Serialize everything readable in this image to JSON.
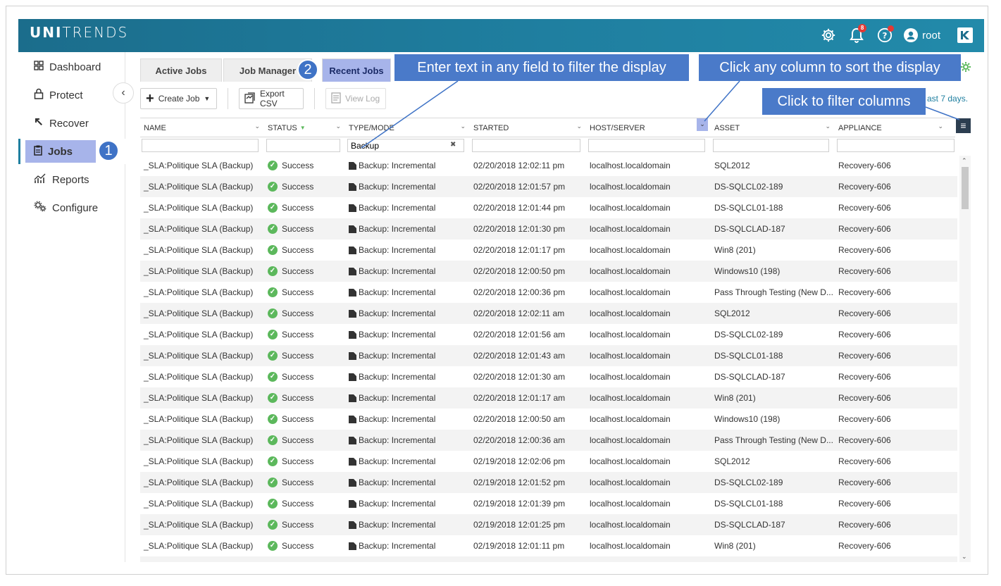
{
  "header": {
    "logo_bold": "UNI",
    "logo_light": "TRENDS",
    "notifications_count": "8",
    "user": "root"
  },
  "sidebar": {
    "items": [
      {
        "label": "Dashboard",
        "icon": "grid-icon"
      },
      {
        "label": "Protect",
        "icon": "lock-icon"
      },
      {
        "label": "Recover",
        "icon": "recover-arrow-icon"
      },
      {
        "label": "Jobs",
        "icon": "clipboard-icon"
      },
      {
        "label": "Reports",
        "icon": "chart-icon"
      },
      {
        "label": "Configure",
        "icon": "gears-icon"
      }
    ],
    "active": "Jobs"
  },
  "callouts": {
    "one": "1",
    "two": "2"
  },
  "tabs": [
    "Active Jobs",
    "Job Manager",
    "Recent Jobs"
  ],
  "toolbar": {
    "create_job": "Create Job",
    "export_csv": "Export CSV",
    "view_log": "View Log",
    "range_hint": "ast 7 days."
  },
  "annotations": {
    "filter_hint": "Enter text in any field to filter the display",
    "sort_hint": "Click any column to sort the display",
    "columns_hint": "Click to filter columns"
  },
  "grid": {
    "columns": [
      "NAME",
      "STATUS",
      "TYPE/MODE",
      "STARTED",
      "HOST/SERVER",
      "ASSET",
      "APPLIANCE"
    ],
    "filter_values": [
      "",
      "",
      "Backup",
      "",
      "",
      "",
      ""
    ],
    "rows": [
      [
        "_SLA:Politique SLA (Backup)",
        "Success",
        "Backup: Incremental",
        "02/20/2018 12:02:11 pm",
        "localhost.localdomain",
        "SQL2012",
        "Recovery-606"
      ],
      [
        "_SLA:Politique SLA (Backup)",
        "Success",
        "Backup: Incremental",
        "02/20/2018 12:01:57 pm",
        "localhost.localdomain",
        "DS-SQLCL02-189",
        "Recovery-606"
      ],
      [
        "_SLA:Politique SLA (Backup)",
        "Success",
        "Backup: Incremental",
        "02/20/2018 12:01:44 pm",
        "localhost.localdomain",
        "DS-SQLCL01-188",
        "Recovery-606"
      ],
      [
        "_SLA:Politique SLA (Backup)",
        "Success",
        "Backup: Incremental",
        "02/20/2018 12:01:30 pm",
        "localhost.localdomain",
        "DS-SQLCLAD-187",
        "Recovery-606"
      ],
      [
        "_SLA:Politique SLA (Backup)",
        "Success",
        "Backup: Incremental",
        "02/20/2018 12:01:17 pm",
        "localhost.localdomain",
        "Win8 (201)",
        "Recovery-606"
      ],
      [
        "_SLA:Politique SLA (Backup)",
        "Success",
        "Backup: Incremental",
        "02/20/2018 12:00:50 pm",
        "localhost.localdomain",
        "Windows10 (198)",
        "Recovery-606"
      ],
      [
        "_SLA:Politique SLA (Backup)",
        "Success",
        "Backup: Incremental",
        "02/20/2018 12:00:36 pm",
        "localhost.localdomain",
        "Pass Through Testing (New D...",
        "Recovery-606"
      ],
      [
        "_SLA:Politique SLA (Backup)",
        "Success",
        "Backup: Incremental",
        "02/20/2018 12:02:11 am",
        "localhost.localdomain",
        "SQL2012",
        "Recovery-606"
      ],
      [
        "_SLA:Politique SLA (Backup)",
        "Success",
        "Backup: Incremental",
        "02/20/2018 12:01:56 am",
        "localhost.localdomain",
        "DS-SQLCL02-189",
        "Recovery-606"
      ],
      [
        "_SLA:Politique SLA (Backup)",
        "Success",
        "Backup: Incremental",
        "02/20/2018 12:01:43 am",
        "localhost.localdomain",
        "DS-SQLCL01-188",
        "Recovery-606"
      ],
      [
        "_SLA:Politique SLA (Backup)",
        "Success",
        "Backup: Incremental",
        "02/20/2018 12:01:30 am",
        "localhost.localdomain",
        "DS-SQLCLAD-187",
        "Recovery-606"
      ],
      [
        "_SLA:Politique SLA (Backup)",
        "Success",
        "Backup: Incremental",
        "02/20/2018 12:01:17 am",
        "localhost.localdomain",
        "Win8 (201)",
        "Recovery-606"
      ],
      [
        "_SLA:Politique SLA (Backup)",
        "Success",
        "Backup: Incremental",
        "02/20/2018 12:00:50 am",
        "localhost.localdomain",
        "Windows10 (198)",
        "Recovery-606"
      ],
      [
        "_SLA:Politique SLA (Backup)",
        "Success",
        "Backup: Incremental",
        "02/20/2018 12:00:36 am",
        "localhost.localdomain",
        "Pass Through Testing (New D...",
        "Recovery-606"
      ],
      [
        "_SLA:Politique SLA (Backup)",
        "Success",
        "Backup: Incremental",
        "02/19/2018 12:02:06 pm",
        "localhost.localdomain",
        "SQL2012",
        "Recovery-606"
      ],
      [
        "_SLA:Politique SLA (Backup)",
        "Success",
        "Backup: Incremental",
        "02/19/2018 12:01:52 pm",
        "localhost.localdomain",
        "DS-SQLCL02-189",
        "Recovery-606"
      ],
      [
        "_SLA:Politique SLA (Backup)",
        "Success",
        "Backup: Incremental",
        "02/19/2018 12:01:39 pm",
        "localhost.localdomain",
        "DS-SQLCL01-188",
        "Recovery-606"
      ],
      [
        "_SLA:Politique SLA (Backup)",
        "Success",
        "Backup: Incremental",
        "02/19/2018 12:01:25 pm",
        "localhost.localdomain",
        "DS-SQLCLAD-187",
        "Recovery-606"
      ],
      [
        "_SLA:Politique SLA (Backup)",
        "Success",
        "Backup: Incremental",
        "02/19/2018 12:01:11 pm",
        "localhost.localdomain",
        "Win8 (201)",
        "Recovery-606"
      ]
    ]
  },
  "colors": {
    "header_bg": "#1f7fa0",
    "active_tab": "#a7b4ea",
    "annotation_bg": "#4a7ac9",
    "success": "#5cb85c",
    "badge": "#e53935"
  }
}
